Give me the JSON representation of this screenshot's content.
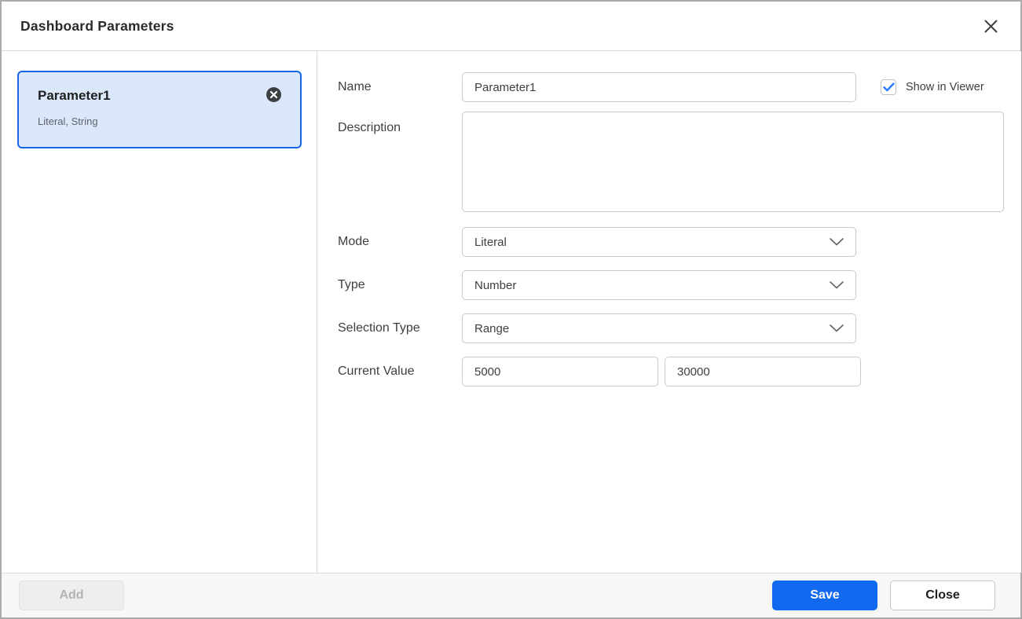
{
  "dialog": {
    "title": "Dashboard Parameters"
  },
  "sidebar": {
    "card": {
      "title": "Parameter1",
      "subtitle": "Literal, String"
    }
  },
  "form": {
    "name": {
      "label": "Name",
      "value": "Parameter1"
    },
    "show_in_viewer": {
      "label": "Show in Viewer",
      "checked": true
    },
    "description": {
      "label": "Description",
      "value": ""
    },
    "mode": {
      "label": "Mode",
      "value": "Literal"
    },
    "type": {
      "label": "Type",
      "value": "Number"
    },
    "selection_type": {
      "label": "Selection Type",
      "value": "Range"
    },
    "current_value": {
      "label": "Current Value",
      "from": "5000",
      "to": "30000"
    }
  },
  "footer": {
    "add_label": "Add",
    "save_label": "Save",
    "close_label": "Close"
  },
  "colors": {
    "accent_blue": "#1169f0",
    "card_background": "#dbe8fc",
    "card_border": "#1766e8",
    "checkbox_check": "#2979ff",
    "delete_icon_circle": "#3c4043"
  }
}
